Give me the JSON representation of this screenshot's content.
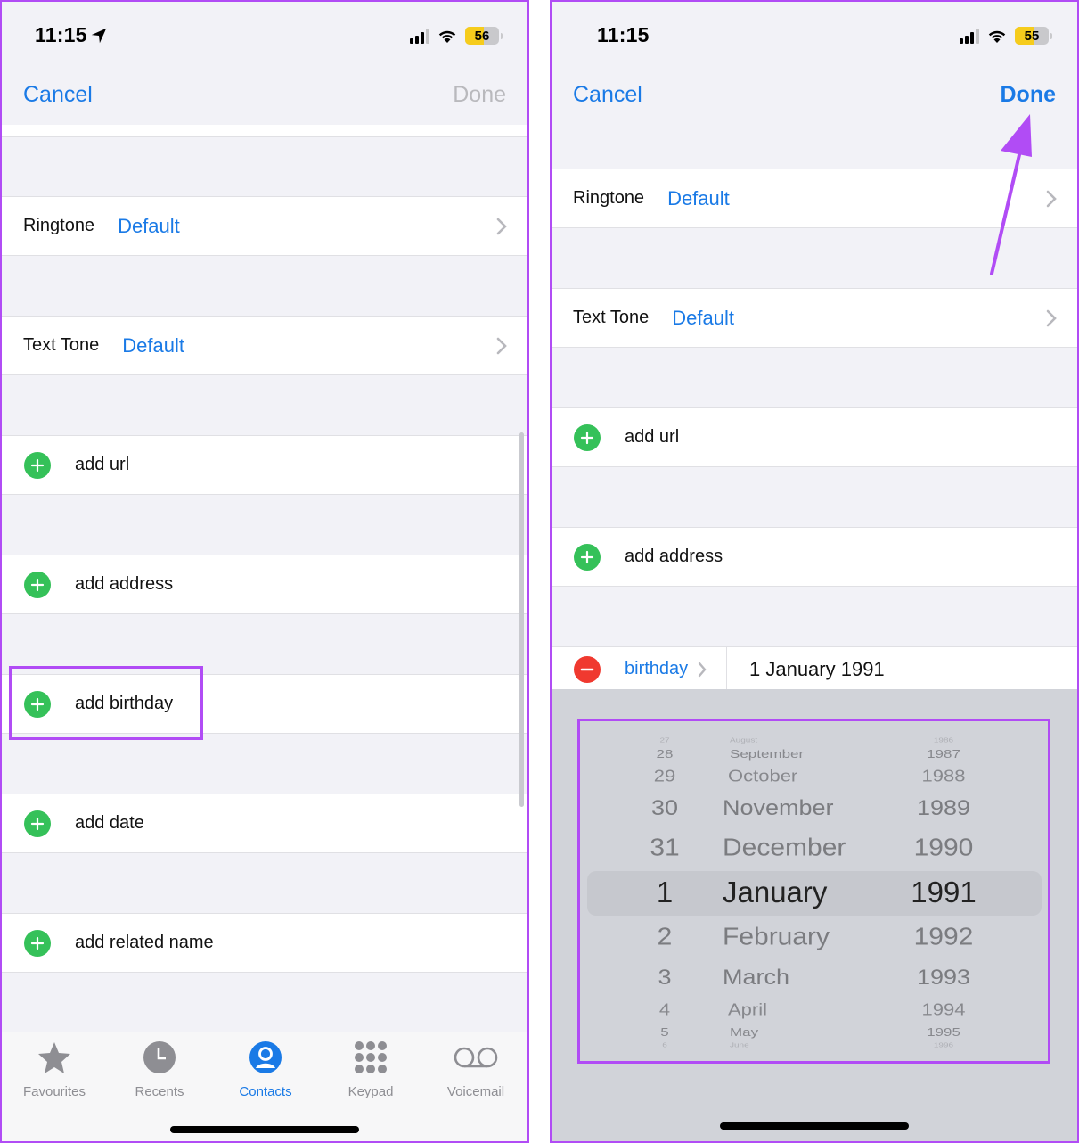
{
  "colors": {
    "accent": "#1a7ae6",
    "annotation": "#b14cf5",
    "add_green": "#35c159",
    "remove_red": "#f0392f",
    "battery_yellow": "#f6cc1c"
  },
  "left": {
    "status": {
      "time": "11:15",
      "battery": "56",
      "battery_level_percent": 56,
      "location_icon": "location-arrow-icon"
    },
    "nav": {
      "cancel": "Cancel",
      "done": "Done",
      "done_enabled": false
    },
    "rows": {
      "ringtone": {
        "label": "Ringtone",
        "value": "Default"
      },
      "text_tone": {
        "label": "Text Tone",
        "value": "Default"
      },
      "add_url": "add url",
      "add_address": "add address",
      "add_birthday": "add birthday",
      "add_date": "add date",
      "add_related_name": "add related name"
    },
    "tabbar": {
      "items": [
        {
          "label": "Favourites",
          "icon": "star-icon",
          "active": false
        },
        {
          "label": "Recents",
          "icon": "clock-icon",
          "active": false
        },
        {
          "label": "Contacts",
          "icon": "person-circle-icon",
          "active": true
        },
        {
          "label": "Keypad",
          "icon": "keypad-icon",
          "active": false
        },
        {
          "label": "Voicemail",
          "icon": "voicemail-icon",
          "active": false
        }
      ]
    },
    "annotation": "highlight around add birthday"
  },
  "right": {
    "status": {
      "time": "11:15",
      "battery": "55",
      "battery_level_percent": 55
    },
    "nav": {
      "cancel": "Cancel",
      "done": "Done",
      "done_enabled": true
    },
    "rows": {
      "ringtone": {
        "label": "Ringtone",
        "value": "Default"
      },
      "text_tone": {
        "label": "Text Tone",
        "value": "Default"
      },
      "add_url": "add url",
      "add_address": "add address",
      "birthday": {
        "label": "birthday",
        "value": "1 January 1991"
      }
    },
    "picker": {
      "days": [
        "27",
        "28",
        "29",
        "30",
        "31",
        "1",
        "2",
        "3",
        "4",
        "5",
        "6"
      ],
      "months": [
        "August",
        "September",
        "October",
        "November",
        "December",
        "January",
        "February",
        "March",
        "April",
        "May",
        "June"
      ],
      "years": [
        "1986",
        "1987",
        "1988",
        "1989",
        "1990",
        "1991",
        "1992",
        "1993",
        "1994",
        "1995",
        "1996"
      ],
      "selected": {
        "day": "1",
        "month": "January",
        "year": "1991"
      }
    },
    "annotation": "arrow pointing to Done; highlight around date picker"
  }
}
